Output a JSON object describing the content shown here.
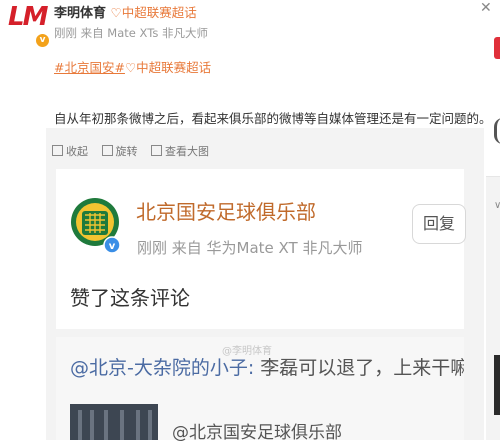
{
  "post": {
    "author": {
      "avatar_text": "LM",
      "name": "李明体育",
      "topic_tag": "中超联赛超话",
      "meta": "刚刚 来自 Mate XTs 非凡大师"
    },
    "hashtags": {
      "tag1": "#北京国安#",
      "tag2": "中超联赛超话"
    },
    "text": "自从年初那条微博之后，看起来俱乐部的微博等自媒体管理还是有一定问题的。",
    "image_tools": {
      "collapse": "收起",
      "rotate": "旋转",
      "view_large": "查看大图"
    }
  },
  "embedded_screenshot": {
    "club_name": "北京国安足球俱乐部",
    "club_meta": "刚刚  来自 华为Mate XT 非凡大师",
    "reply_button": "回复",
    "liked_text": "赞了这条评论",
    "comment_at": "@北京-大杂院的小子:",
    "comment_text": " 李磊可以退了，上来干嘛",
    "watermark": "@李明体育",
    "reply_line": "@北京国安足球俱乐部"
  },
  "colors": {
    "accent_orange": "#e8793a",
    "club_brown": "#c06a2b",
    "verified_badge": "#f3a21b",
    "link_blue": "#4b6ba3"
  },
  "icons": [
    "verified-badge-icon",
    "super-topic-icon",
    "collapse-icon",
    "rotate-icon",
    "view-large-icon"
  ]
}
